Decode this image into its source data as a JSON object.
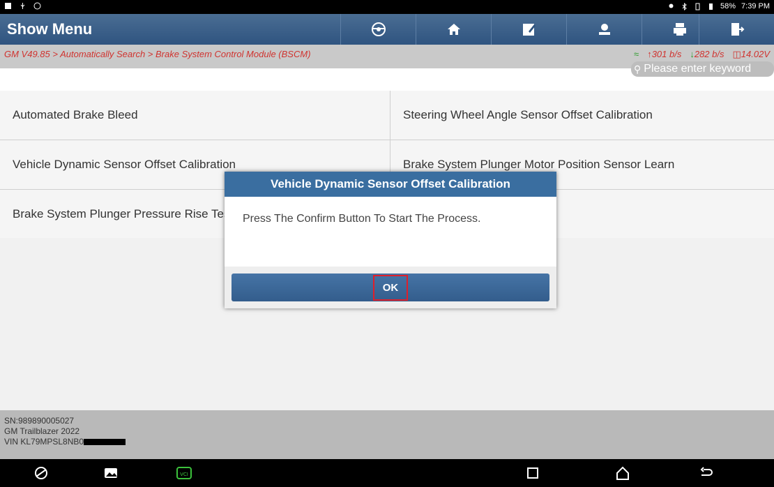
{
  "status_bar": {
    "battery": "58%",
    "time": "7:39 PM"
  },
  "header": {
    "title": "Show Menu",
    "buttons": [
      {
        "icon": "steering-wheel-icon"
      },
      {
        "icon": "home-icon"
      },
      {
        "icon": "edit-report-icon"
      },
      {
        "icon": "user-icon"
      },
      {
        "icon": "print-icon"
      },
      {
        "icon": "exit-icon"
      }
    ]
  },
  "breadcrumb": "GM V49.85 > Automatically Search > Brake System Control Module (BSCM)",
  "network": {
    "upload": "301 b/s",
    "download": "282 b/s",
    "voltage": "14.02V"
  },
  "search": {
    "placeholder": "Please enter keyword"
  },
  "menu_items": [
    [
      "Automated Brake Bleed",
      "Steering Wheel Angle Sensor Offset Calibration"
    ],
    [
      "Vehicle Dynamic Sensor Offset Calibration",
      "Brake System Plunger Motor Position Sensor Learn"
    ],
    [
      "Brake System Plunger Pressure Rise Test",
      ""
    ]
  ],
  "footer": {
    "sn": "SN:989890005027",
    "vehicle": "GM Trailblazer 2022",
    "vin": "VIN KL79MPSL8NB0"
  },
  "dialog": {
    "title": "Vehicle Dynamic Sensor Offset Calibration",
    "message": "Press The Confirm Button To Start The Process.",
    "ok_label": "OK"
  },
  "colors": {
    "header": "#2f5480",
    "accent_red": "#d0332f",
    "dialog_title": "#3a6ea0"
  }
}
